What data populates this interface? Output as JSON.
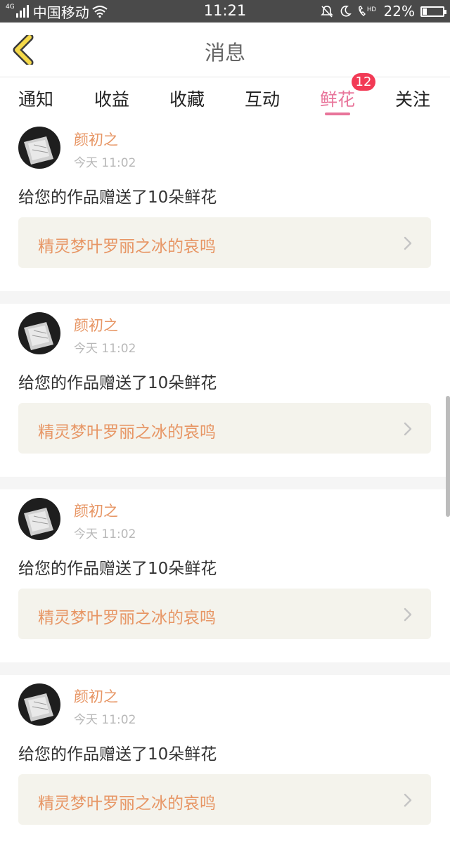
{
  "status_bar": {
    "carrier": "中国移动",
    "network_tag": "4G",
    "time": "11:21",
    "battery_percent": "22%",
    "battery_level": 0.22,
    "icons": [
      "signal-icon",
      "wifi-icon",
      "mute-icon",
      "moon-icon",
      "hd-call-icon",
      "battery-icon"
    ]
  },
  "header": {
    "title": "消息",
    "back_icon": "chevron-left-icon",
    "back_color": "#f5b400"
  },
  "tabs": {
    "items": [
      {
        "label": "通知"
      },
      {
        "label": "收益"
      },
      {
        "label": "收藏"
      },
      {
        "label": "互动"
      },
      {
        "label": "鲜花",
        "active": true,
        "badge": "12"
      },
      {
        "label": "关注"
      }
    ],
    "active_color": "#e8749a",
    "badge_color": "#f23a55"
  },
  "feed": {
    "items": [
      {
        "user": "颜初之",
        "time": "今天 11:02",
        "message": "给您的作品赠送了10朵鲜花",
        "work_title": "精灵梦叶罗丽之冰的哀鸣"
      },
      {
        "user": "颜初之",
        "time": "今天 11:02",
        "message": "给您的作品赠送了10朵鲜花",
        "work_title": "精灵梦叶罗丽之冰的哀鸣"
      },
      {
        "user": "颜初之",
        "time": "今天 11:02",
        "message": "给您的作品赠送了10朵鲜花",
        "work_title": "精灵梦叶罗丽之冰的哀鸣"
      },
      {
        "user": "颜初之",
        "time": "今天 11:02",
        "message": "给您的作品赠送了10朵鲜花",
        "work_title": "精灵梦叶罗丽之冰的哀鸣"
      }
    ],
    "accent_color": "#e79665"
  }
}
